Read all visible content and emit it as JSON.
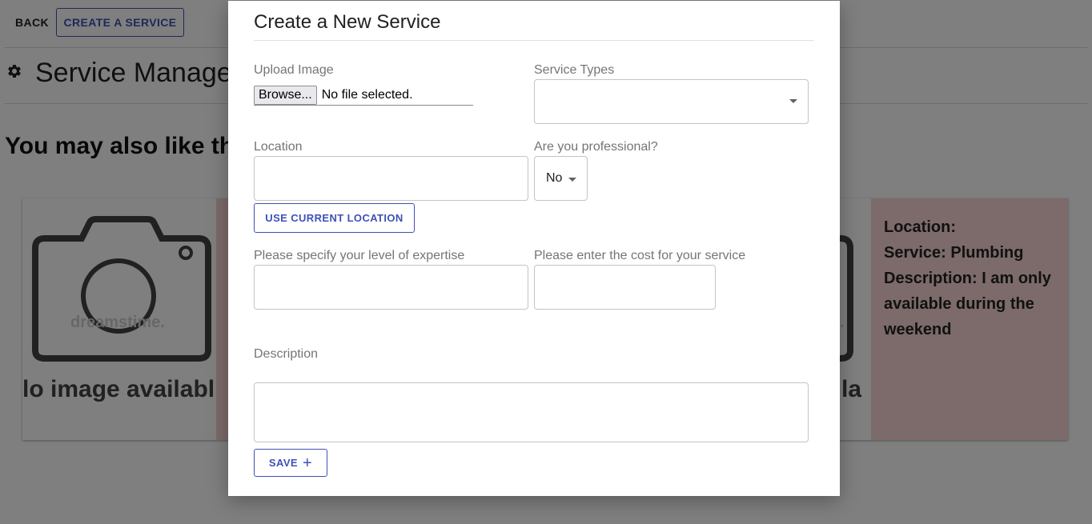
{
  "topbar": {
    "back_label": "BACK",
    "create_label": "CREATE A SERVICE"
  },
  "page": {
    "title": "Service Manage",
    "section_heading": "You may also like th"
  },
  "cards": [
    {
      "no_image_text": "lo image availabl",
      "watermark": "dreamstime."
    },
    {
      "no_image_text": "aila",
      "watermark": "e.",
      "location_line": "Location:",
      "service_line": "Service: Plumbing",
      "description_line": "Description: I am only available during the weekend"
    }
  ],
  "modal": {
    "title": "Create a New Service",
    "upload_label": "Upload Image",
    "browse_label": "Browse...",
    "file_status": "No file selected.",
    "service_types_label": "Service Types",
    "service_types_value": "",
    "location_label": "Location",
    "location_value": "",
    "professional_label": "Are you professional?",
    "professional_value": "No",
    "use_location_label": "USE CURRENT LOCATION",
    "expertise_label": "Please specify your level of expertise",
    "expertise_value": "",
    "cost_label": "Please enter the cost for your service",
    "cost_value": "",
    "description_label": "Description",
    "description_value": "",
    "save_label": "SAVE",
    "save_icon": "+"
  },
  "colors": {
    "primary": "#3f51b5",
    "card_side": "#f8d7d5",
    "overlay": "rgba(0,0,0,0.5)"
  }
}
